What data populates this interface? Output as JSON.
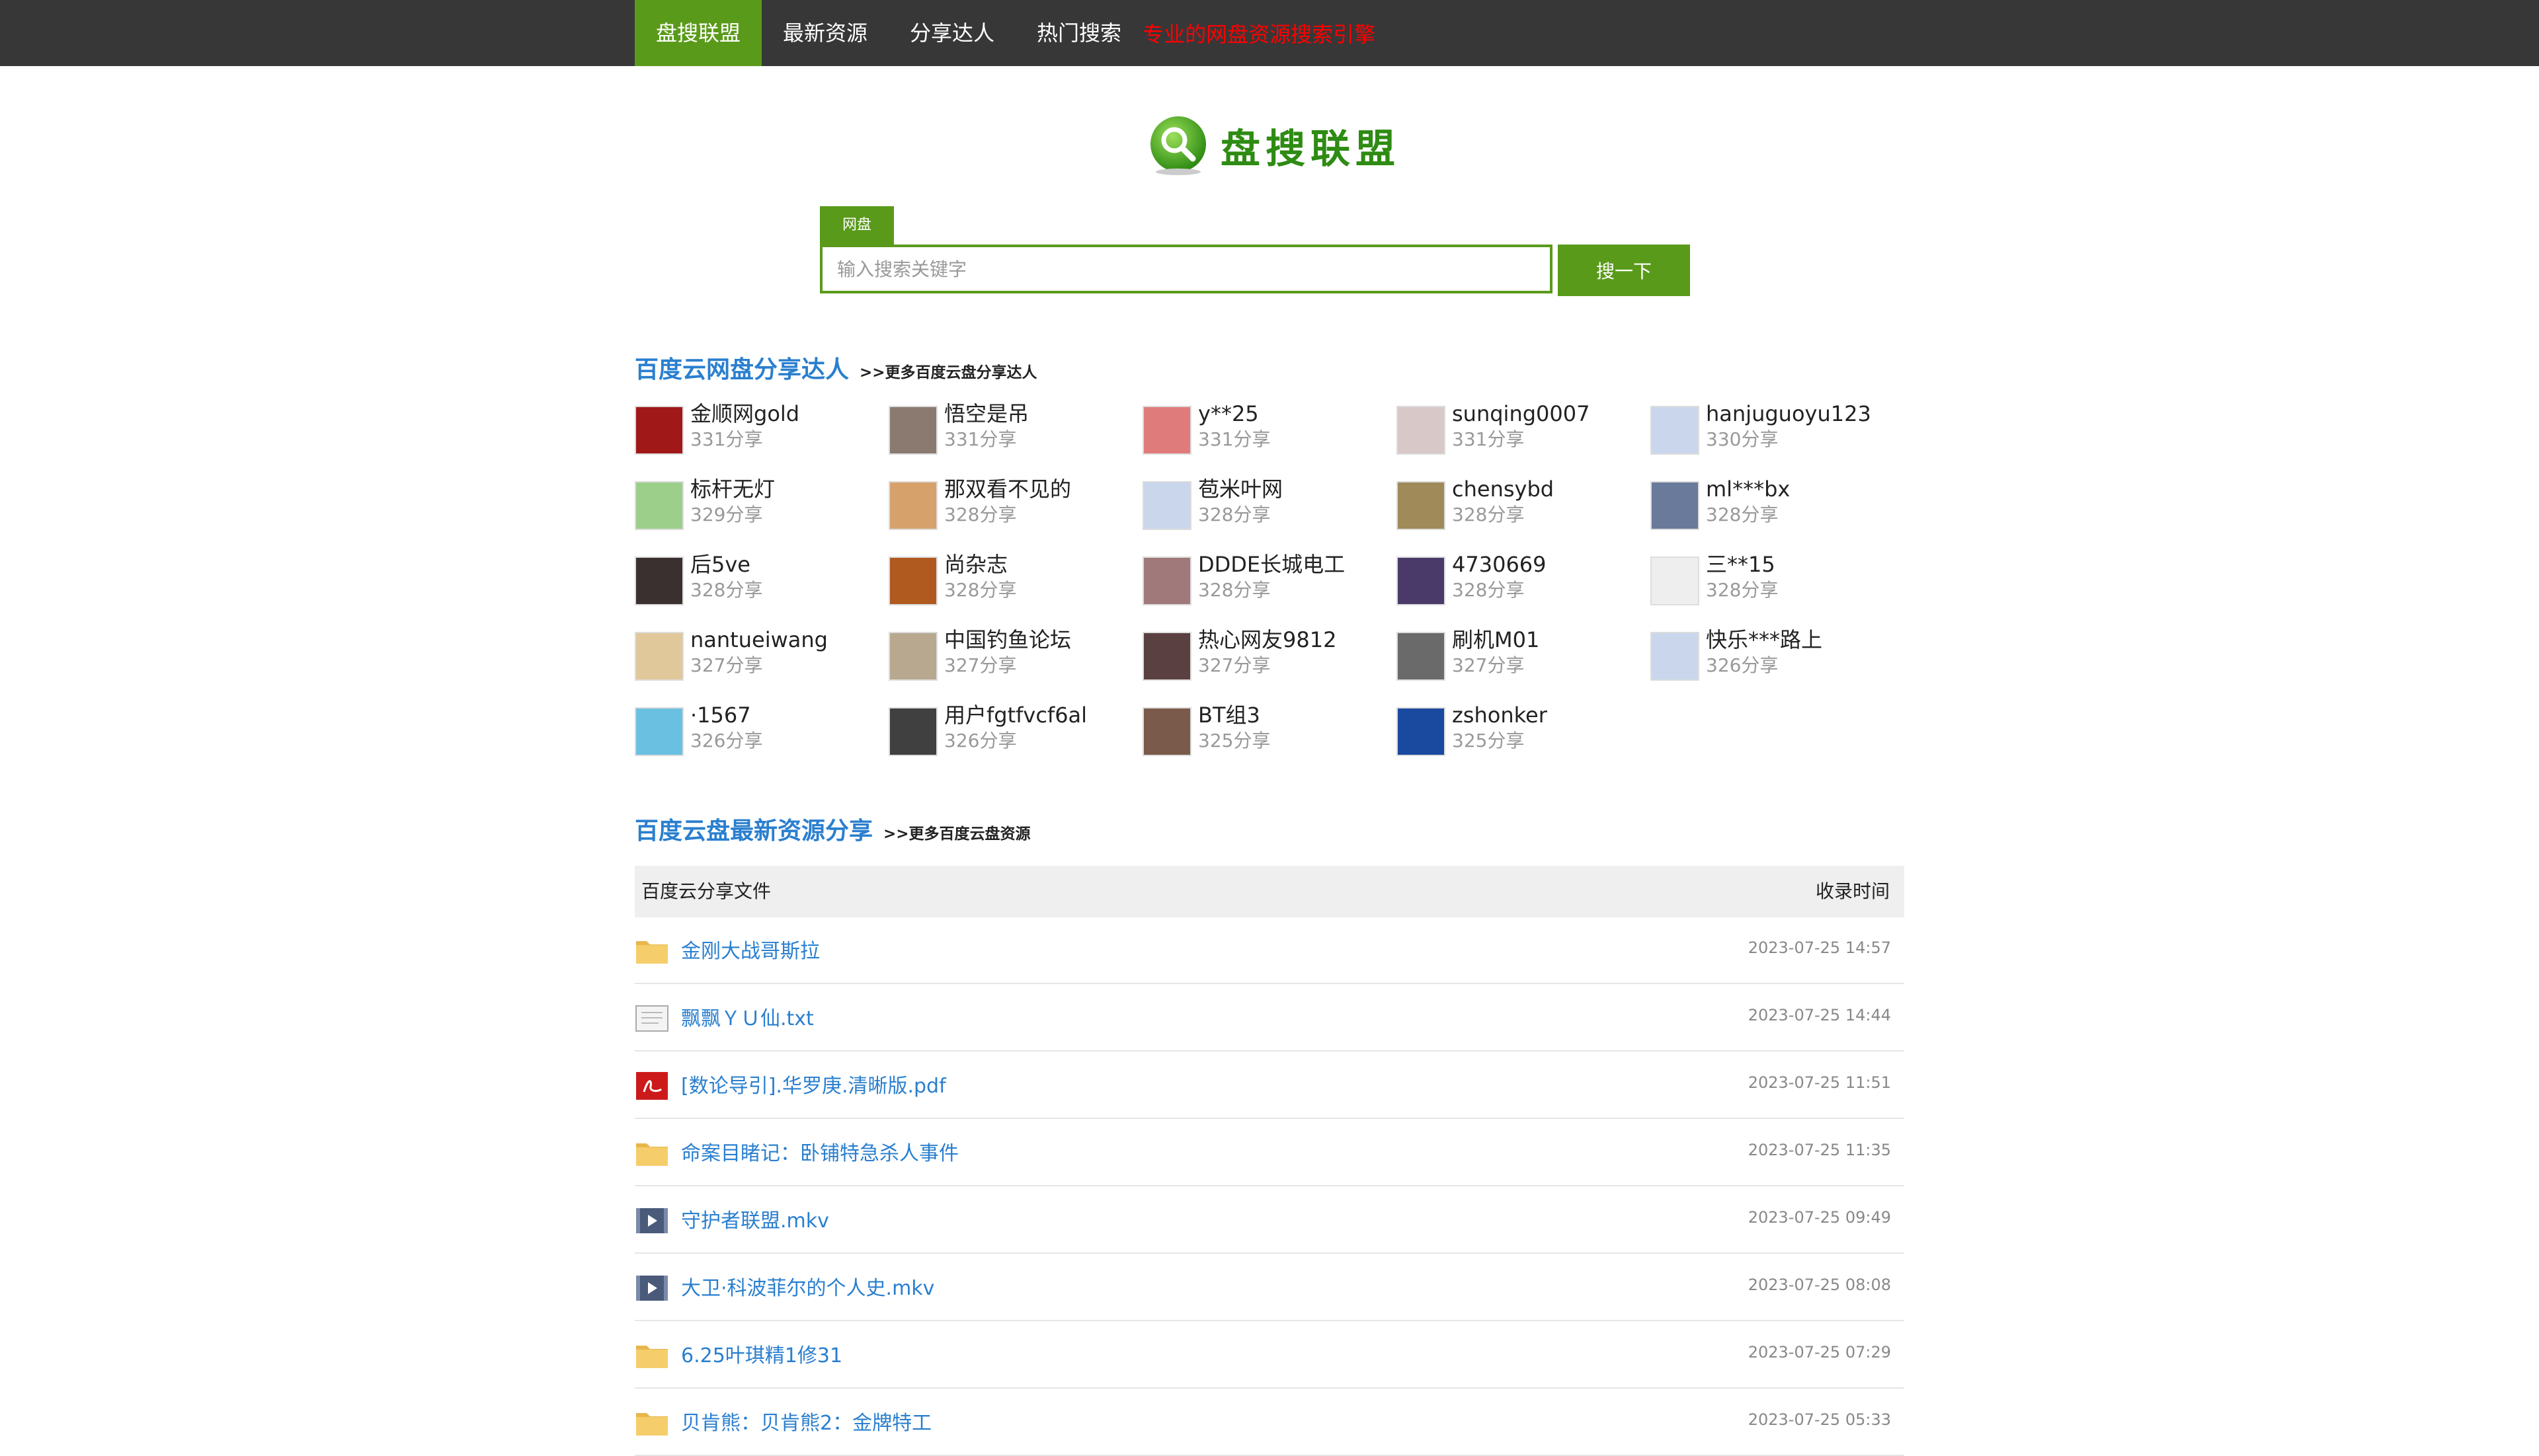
{
  "nav": {
    "items": [
      "盘搜联盟",
      "最新资源",
      "分享达人",
      "热门搜索"
    ],
    "slogan": "专业的网盘资源搜索引擎"
  },
  "logo": {
    "text": "盘搜联盟"
  },
  "search": {
    "tab": "网盘",
    "placeholder": "输入搜索关键字",
    "value": "",
    "button": "搜一下"
  },
  "sharers_section": {
    "title": "百度云网盘分享达人",
    "more": ">>更多百度云盘分享达人",
    "items": [
      {
        "name": "金顺网gold",
        "count": "331分享",
        "color": "#a01818"
      },
      {
        "name": "悟空是吊",
        "count": "331分享",
        "color": "#8a7a70"
      },
      {
        "name": "y**25",
        "count": "331分享",
        "color": "#e07b7b"
      },
      {
        "name": "sunqing0007",
        "count": "331分享",
        "color": "#d9c8c8"
      },
      {
        "name": "hanjuguoyu123",
        "count": "330分享",
        "color": "#c9d6ec"
      },
      {
        "name": "标杆无灯",
        "count": "329分享",
        "color": "#9ccf8a"
      },
      {
        "name": "那双看不见的",
        "count": "328分享",
        "color": "#d6a16b"
      },
      {
        "name": "苞米叶网",
        "count": "328分享",
        "color": "#c9d6ec"
      },
      {
        "name": "chensybd",
        "count": "328分享",
        "color": "#a08a5a"
      },
      {
        "name": "ml***bx",
        "count": "328分享",
        "color": "#6a7a9a"
      },
      {
        "name": "后5ve",
        "count": "328分享",
        "color": "#3a3030"
      },
      {
        "name": "尚杂志",
        "count": "328分享",
        "color": "#b05a20"
      },
      {
        "name": "DDDE长城电工",
        "count": "328分享",
        "color": "#a07a7a"
      },
      {
        "name": "4730669",
        "count": "328分享",
        "color": "#4a3a6a"
      },
      {
        "name": "三**15",
        "count": "328分享",
        "color": "#eeeeee"
      },
      {
        "name": "nantueiwang",
        "count": "327分享",
        "color": "#e0c89a"
      },
      {
        "name": "中国钓鱼论坛",
        "count": "327分享",
        "color": "#b8a890"
      },
      {
        "name": "热心网友9812",
        "count": "327分享",
        "color": "#5a4040"
      },
      {
        "name": "刷机M01",
        "count": "327分享",
        "color": "#6a6a6a"
      },
      {
        "name": "快乐***路上",
        "count": "326分享",
        "color": "#c9d6ec"
      },
      {
        "name": "·1567",
        "count": "326分享",
        "color": "#6ac0e0"
      },
      {
        "name": "用户fgtfvcf6al",
        "count": "326分享",
        "color": "#404040"
      },
      {
        "name": "BT组3",
        "count": "325分享",
        "color": "#7a5a4a"
      },
      {
        "name": "zshonker",
        "count": "325分享",
        "color": "#1a4aa0"
      }
    ]
  },
  "files_section": {
    "title": "百度云盘最新资源分享",
    "more": ">>更多百度云盘资源",
    "col_file": "百度云分享文件",
    "col_time": "收录时间",
    "rows": [
      {
        "name": "金刚大战哥斯拉",
        "time": "2023-07-25 14:57",
        "icon": "folder-icon"
      },
      {
        "name": "飘飘ＹＵ仙.txt",
        "time": "2023-07-25 14:44",
        "icon": "text-file-icon"
      },
      {
        "name": "[数论导引].华罗庚.清晰版.pdf",
        "time": "2023-07-25 11:51",
        "icon": "pdf-icon"
      },
      {
        "name": "命案目睹记：卧铺特急杀人事件",
        "time": "2023-07-25 11:35",
        "icon": "folder-icon"
      },
      {
        "name": "守护者联盟.mkv",
        "time": "2023-07-25 09:49",
        "icon": "video-icon"
      },
      {
        "name": "大卫·科波菲尔的个人史.mkv",
        "time": "2023-07-25 08:08",
        "icon": "video-icon"
      },
      {
        "name": "6.25叶琪精1修31",
        "time": "2023-07-25 07:29",
        "icon": "folder-icon"
      },
      {
        "name": "贝肯熊：贝肯熊2：金牌特工",
        "time": "2023-07-25 05:33",
        "icon": "folder-icon"
      }
    ]
  }
}
